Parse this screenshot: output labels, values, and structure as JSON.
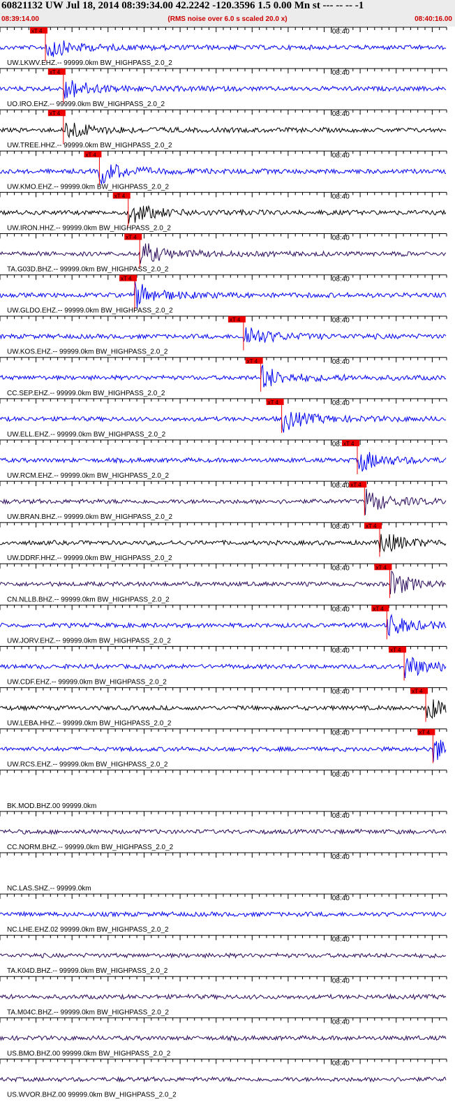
{
  "header": {
    "title": "60821132 UW Jul 18, 2014 08:39:34.00   42.2242 -120.3596  1.5 0.00 Mn st --- -- --  -1",
    "start_time": "08:39:14.00",
    "end_time": "08:40:16.00",
    "note": "(RMS noise over 6.0 s scaled 20.0 x)"
  },
  "colors": {
    "blue": "#0000ee",
    "black": "#000000",
    "purple": "#2a0a5a",
    "pick": "#ee0000",
    "background": "#ffffff",
    "header_bg": "#ececec"
  },
  "chart_data": {
    "type": "line",
    "x_start": "08:39:14.00",
    "x_end": "08:40:16.00",
    "time_marker_label": "08:40",
    "pick_label": "xT 4",
    "traces": [
      {
        "label": "UW.LKWV.EHZ.-- 99999.0km BW_HIGHPASS_2.0_2",
        "color": "blue",
        "pick": "08:39:20.3"
      },
      {
        "label": "UO.IRO.EHZ.-- 99999.0km BW_HIGHPASS_2.0_2",
        "color": "blue",
        "pick": "08:39:22.8"
      },
      {
        "label": "UW.TREE.HHZ.-- 99999.0km BW_HIGHPASS_2.0_2",
        "color": "black",
        "pick": "08:39:22.8"
      },
      {
        "label": "UW.KMO.EHZ.-- 99999.0km BW_HIGHPASS_2.0_2",
        "color": "blue",
        "pick": "08:39:27.8"
      },
      {
        "label": "UW.IRON.HHZ.-- 99999.0km BW_HIGHPASS_2.0_2",
        "color": "black",
        "pick": "08:39:31.8"
      },
      {
        "label": "TA.G03D.BHZ.-- 99999.0km BW_HIGHPASS_2.0_2",
        "color": "purple",
        "pick": "08:39:33.4"
      },
      {
        "label": "UW.GLDO.EHZ.-- 99999.0km BW_HIGHPASS_2.0_2",
        "color": "blue",
        "pick": "08:39:32.7"
      },
      {
        "label": "UW.KOS.EHZ.-- 99999.0km BW_HIGHPASS_2.0_2",
        "color": "blue",
        "pick": "08:39:47.8"
      },
      {
        "label": "CC.SEP.EHZ.-- 99999.0km BW_HIGHPASS_2.0_2",
        "color": "blue",
        "pick": "08:39:50.2"
      },
      {
        "label": "UW.ELL.EHZ.-- 99999.0km BW_HIGHPASS_2.0_2",
        "color": "blue",
        "pick": "08:39:53.1"
      },
      {
        "label": "UW.RCM.EHZ.-- 99999.0km BW_HIGHPASS_2.0_2",
        "color": "blue",
        "pick": "08:40:03.6"
      },
      {
        "label": "UW.BRAN.BHZ.-- 99999.0km BW_HIGHPASS_2.0_2",
        "color": "purple",
        "pick": "08:40:04.6"
      },
      {
        "label": "UW.DDRF.HHZ.-- 99999.0km BW_HIGHPASS_2.0_2",
        "color": "black",
        "pick": "08:40:06.7"
      },
      {
        "label": "CN.NLLB.BHZ.-- 99999.0km BW_HIGHPASS_2.0_2",
        "color": "purple",
        "pick": "08:40:08.1"
      },
      {
        "label": "UW.JORV.EHZ.-- 99999.0km BW_HIGHPASS_2.0_2",
        "color": "blue",
        "pick": "08:40:07.7"
      },
      {
        "label": "UW.CDF.EHZ.-- 99999.0km BW_HIGHPASS_2.0_2",
        "color": "blue",
        "pick": "08:40:10.1"
      },
      {
        "label": "UW.LEBA.HHZ.-- 99999.0km BW_HIGHPASS_2.0_2",
        "color": "black",
        "pick": "08:40:13.1"
      },
      {
        "label": "UW.RCS.EHZ.-- 99999.0km BW_HIGHPASS_2.0_2",
        "color": "blue",
        "pick": "08:40:14.1"
      },
      {
        "label": "BK.MOD.BHZ.00 99999.0km",
        "color": "none"
      },
      {
        "label": "CC.NORM.BHZ.-- 99999.0km BW_HIGHPASS_2.0_2",
        "color": "purple"
      },
      {
        "label": "NC.LAS.SHZ.-- 99999.0km",
        "color": "none"
      },
      {
        "label": "NC.LHE.EHZ.02 99999.0km BW_HIGHPASS_2.0_2",
        "color": "blue"
      },
      {
        "label": "TA.K04D.BHZ.-- 99999.0km BW_HIGHPASS_2.0_2",
        "color": "purple"
      },
      {
        "label": "TA.M04C.BHZ.-- 99999.0km BW_HIGHPASS_2.0_2",
        "color": "purple"
      },
      {
        "label": "US.BMO.BHZ.00 99999.0km BW_HIGHPASS_2.0_2",
        "color": "purple"
      },
      {
        "label": "US.WVOR.BHZ.00 99999.0km BW_HIGHPASS_2.0_2",
        "color": "purple"
      }
    ]
  }
}
